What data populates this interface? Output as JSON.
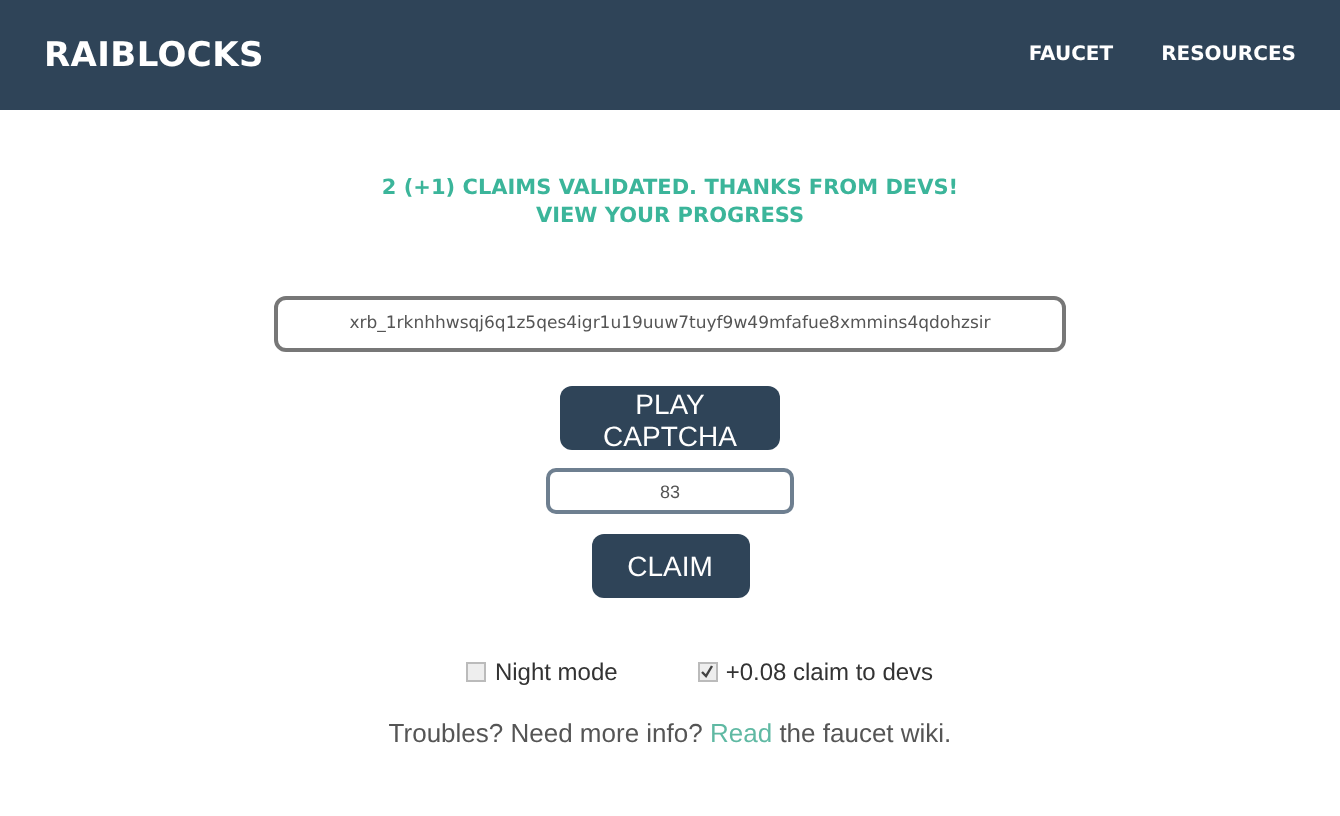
{
  "header": {
    "brand": "RAIBLOCKS",
    "nav": [
      {
        "label": "FAUCET"
      },
      {
        "label": "RESOURCES"
      }
    ]
  },
  "status": {
    "message": "2 (+1) CLAIMS VALIDATED. THANKS FROM DEVS!",
    "link": "VIEW YOUR PROGRESS"
  },
  "address_field": {
    "value": "xrb_1rknhhwsqj6q1z5qes4igr1u19uuw7tuyf9w49mfafue8xmmins4qdohzsir"
  },
  "captcha_button": "PLAY CAPTCHA",
  "captcha_field": {
    "value": "83"
  },
  "claim_button": "CLAIM",
  "options": [
    {
      "label": "Night mode",
      "checked": false
    },
    {
      "label": "+0.08 claim to devs",
      "checked": true
    }
  ],
  "footer": {
    "before": "Troubles? Need more info?",
    "link": "Read",
    "after": "the faucet wiki."
  }
}
